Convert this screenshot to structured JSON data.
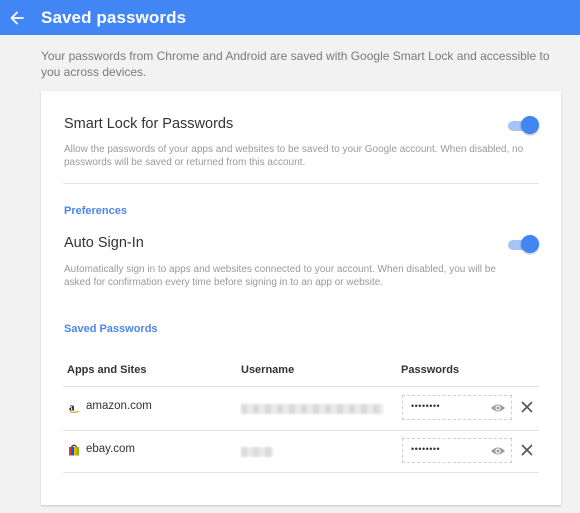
{
  "header": {
    "title": "Saved passwords",
    "back_icon": "arrow-left-icon",
    "background_color": "#4286f5"
  },
  "intro": "Your passwords from Chrome and Android are saved with Google Smart Lock and accessible to you across devices.",
  "smart_lock": {
    "title": "Smart Lock for Passwords",
    "description": "Allow the passwords of your apps and websites to be saved to your Google account. When disabled, no passwords will be saved or returned from this account.",
    "enabled": true
  },
  "preferences": {
    "heading": "Preferences",
    "auto_sign_in": {
      "title": "Auto Sign-In",
      "description": "Automatically sign in to apps and websites connected to your account. When disabled, you will be asked for confirmation every time before signing in to an app or website.",
      "enabled": true
    }
  },
  "saved_passwords": {
    "heading": "Saved Passwords",
    "columns": {
      "site": "Apps and Sites",
      "username": "Username",
      "password": "Passwords"
    },
    "rows": [
      {
        "site": "amazon.com",
        "icon": "amazon-icon",
        "password_mask": "••••••••"
      },
      {
        "site": "ebay.com",
        "icon": "ebay-icon",
        "password_mask": "••••••••"
      }
    ]
  },
  "accent_color": "#4285f4"
}
